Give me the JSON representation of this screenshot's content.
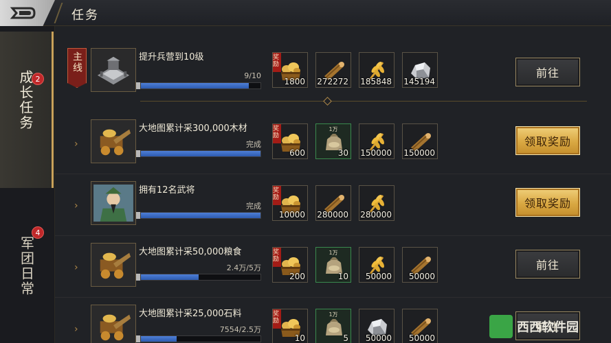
{
  "header": {
    "title": "任务"
  },
  "sidebar": {
    "tabs": [
      {
        "label": "成长任务",
        "badge": "2",
        "active": true
      },
      {
        "label": "军团日常",
        "badge": "4",
        "active": false
      }
    ]
  },
  "main_task": {
    "tag": "主线",
    "title": "提升兵营到10级",
    "progress_text": "9/10",
    "progress": 0.9,
    "rewards": [
      {
        "icon": "gold-chest-icon",
        "qty": "1800",
        "corner": "奖励"
      },
      {
        "icon": "wood-log-icon",
        "qty": "272272"
      },
      {
        "icon": "grain-icon",
        "qty": "185848"
      },
      {
        "icon": "stone-icon",
        "qty": "145194"
      }
    ],
    "button": "前往"
  },
  "tasks": [
    {
      "title": "大地图累计采300,000木材",
      "progress_text": "完成",
      "progress": 1.0,
      "icon": "cart-icon",
      "rewards": [
        {
          "icon": "gold-chest-icon",
          "qty": "600",
          "corner": "奖励"
        },
        {
          "icon": "resource-bag-icon",
          "qty": "30",
          "top": "1万",
          "green": true
        },
        {
          "icon": "grain-icon",
          "qty": "150000"
        },
        {
          "icon": "wood-log-icon",
          "qty": "150000"
        }
      ],
      "button": "领取奖励",
      "button_type": "claim"
    },
    {
      "title": "拥有12名武将",
      "progress_text": "完成",
      "progress": 1.0,
      "icon": "general-portrait-icon",
      "rewards": [
        {
          "icon": "gold-chest-icon",
          "qty": "10000",
          "corner": "奖励"
        },
        {
          "icon": "wood-log-icon",
          "qty": "280000"
        },
        {
          "icon": "grain-icon",
          "qty": "280000"
        }
      ],
      "button": "领取奖励",
      "button_type": "claim"
    },
    {
      "title": "大地图累计采50,000粮食",
      "progress_text": "2.4万/5万",
      "progress": 0.48,
      "icon": "cart-icon",
      "rewards": [
        {
          "icon": "gold-chest-icon",
          "qty": "200",
          "corner": "奖励"
        },
        {
          "icon": "resource-bag-icon",
          "qty": "10",
          "top": "1万",
          "green": true
        },
        {
          "icon": "grain-icon",
          "qty": "50000"
        },
        {
          "icon": "wood-log-icon",
          "qty": "50000"
        }
      ],
      "button": "前往",
      "button_type": "go"
    },
    {
      "title": "大地图累计采25,000石料",
      "progress_text": "7554/2.5万",
      "progress": 0.3,
      "icon": "cart-icon",
      "rewards": [
        {
          "icon": "gold-chest-icon",
          "qty": "10",
          "corner": "奖励"
        },
        {
          "icon": "resource-bag-icon",
          "qty": "5",
          "top": "1万",
          "green": true
        },
        {
          "icon": "stone-icon",
          "qty": "50000"
        },
        {
          "icon": "wood-log-icon",
          "qty": "50000"
        }
      ],
      "button": "前往",
      "button_type": "go"
    }
  ],
  "watermark": "西西软件园",
  "colors": {
    "accent_gold": "#c9a25a",
    "progress_blue": "#3e6fc7",
    "badge_red": "#c0282a"
  }
}
